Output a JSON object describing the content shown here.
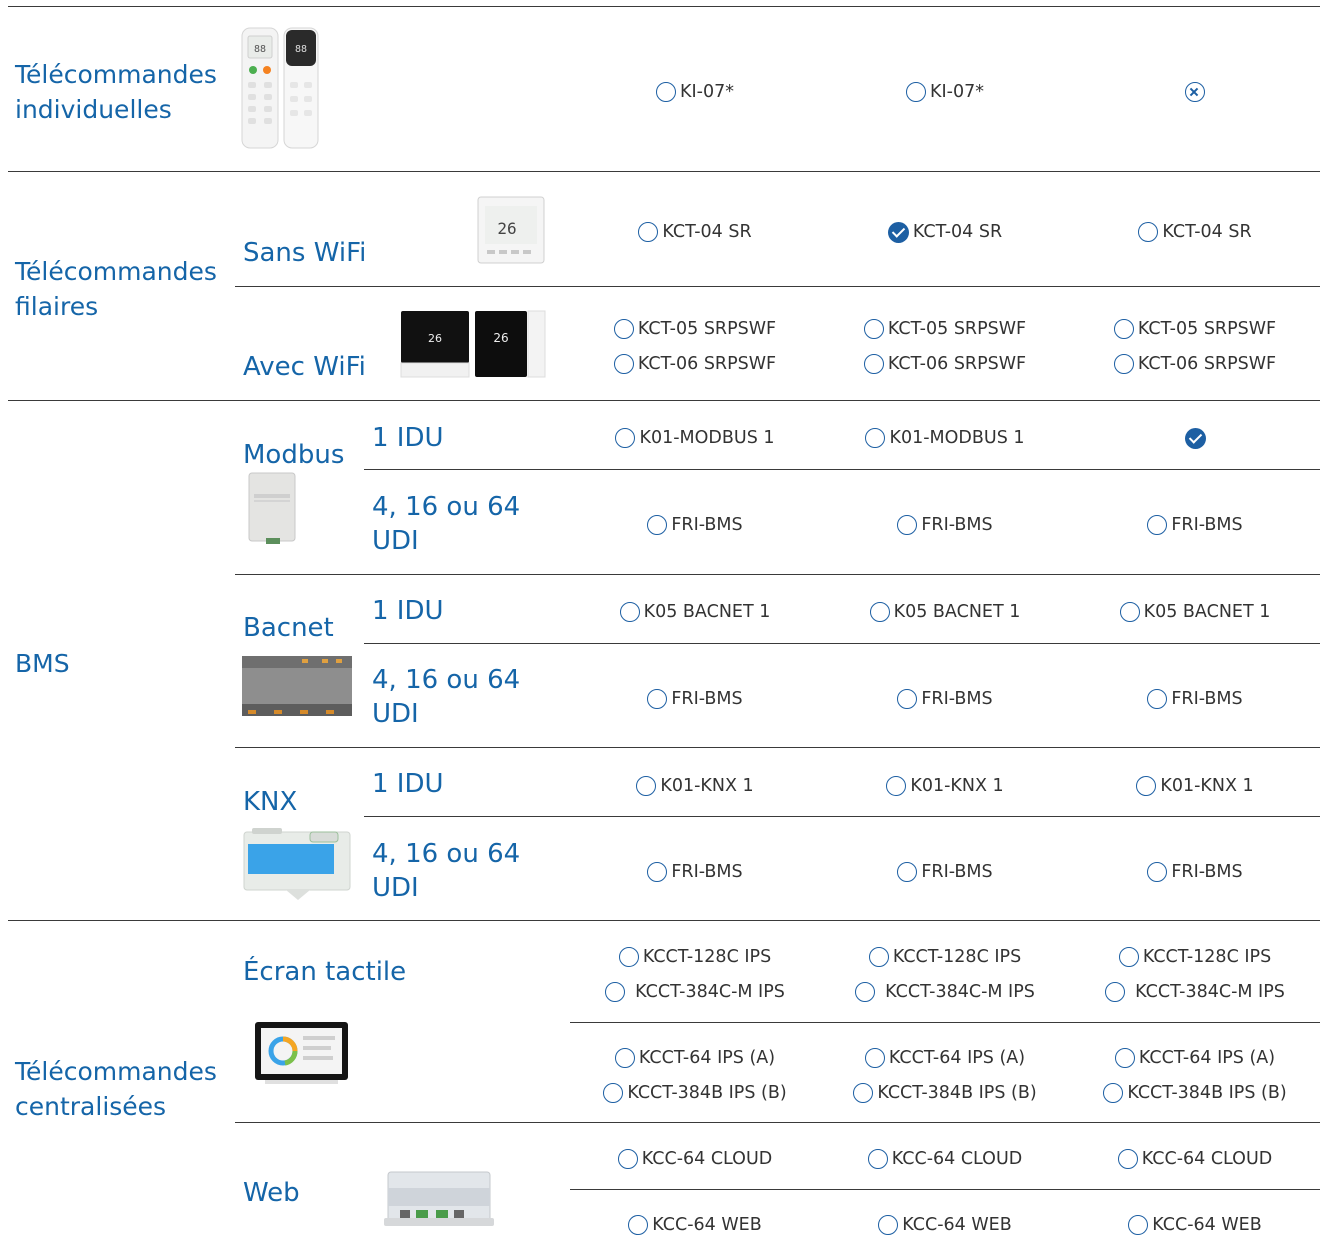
{
  "sections": {
    "individual": {
      "title": [
        "Télécommandes",
        "individuelles"
      ],
      "row": [
        "KI-07*",
        "KI-07*",
        ""
      ],
      "icons": [
        "radio",
        "radio",
        "cross"
      ]
    },
    "wired": {
      "title": [
        "Télécommandes",
        "filaires"
      ],
      "sans_wifi": {
        "label": "Sans WiFi",
        "row": [
          "KCT-04 SR",
          "KCT-04 SR",
          "KCT-04 SR"
        ],
        "icons": [
          "radio",
          "check",
          "radio"
        ]
      },
      "avec_wifi": {
        "label": "Avec WiFi",
        "row1": [
          "KCT-05 SRPSWF",
          "KCT-05 SRPSWF",
          "KCT-05 SRPSWF"
        ],
        "row2": [
          "KCT-06 SRPSWF",
          "KCT-06 SRPSWF",
          "KCT-06 SRPSWF"
        ]
      }
    },
    "bms": {
      "title": "BMS",
      "modbus": {
        "label": "Modbus",
        "idu1_label": "1 IDU",
        "idu1": [
          "K01-MODBUS 1",
          "K01-MODBUS 1",
          ""
        ],
        "idu1_icons": [
          "radio",
          "radio",
          "check"
        ],
        "udi_label": [
          "4, 16 ou 64",
          "UDI"
        ],
        "udi": [
          "FRI-BMS",
          "FRI-BMS",
          "FRI-BMS"
        ]
      },
      "bacnet": {
        "label": "Bacnet",
        "idu1_label": "1 IDU",
        "idu1": [
          "K05 BACNET 1",
          "K05 BACNET 1",
          "K05 BACNET 1"
        ],
        "udi_label": [
          "4, 16 ou 64",
          "UDI"
        ],
        "udi": [
          "FRI-BMS",
          "FRI-BMS",
          "FRI-BMS"
        ]
      },
      "knx": {
        "label": "KNX",
        "idu1_label": "1 IDU",
        "idu1": [
          "K01-KNX 1",
          "K01-KNX 1",
          "K01-KNX 1"
        ],
        "udi_label": [
          "4, 16 ou 64",
          "UDI"
        ],
        "udi": [
          "FRI-BMS",
          "FRI-BMS",
          "FRI-BMS"
        ]
      }
    },
    "central": {
      "title": [
        "Télécommandes",
        "centralisées"
      ],
      "touch": {
        "label": "Écran tactile",
        "a1": [
          "KCCT-128C IPS",
          "KCCT-128C IPS",
          "KCCT-128C IPS"
        ],
        "a2": [
          "KCCT-384C-M IPS",
          "KCCT-384C-M IPS",
          "KCCT-384C-M IPS"
        ],
        "b1": [
          "KCCT-64 IPS (A)",
          "KCCT-64 IPS (A)",
          "KCCT-64 IPS (A)"
        ],
        "b2": [
          "KCCT-384B IPS (B)",
          "KCCT-384B IPS (B)",
          "KCCT-384B IPS (B)"
        ]
      },
      "web": {
        "label": "Web",
        "cloud": [
          "KCC-64 CLOUD",
          "KCC-64 CLOUD",
          "KCC-64 CLOUD"
        ],
        "web": [
          "KCC-64 WEB",
          "KCC-64 WEB",
          "KCC-64 WEB"
        ]
      }
    }
  },
  "colors": {
    "accent": "#1565a8",
    "icon": "#1d5fa3",
    "rule": "#3a3a3a"
  }
}
